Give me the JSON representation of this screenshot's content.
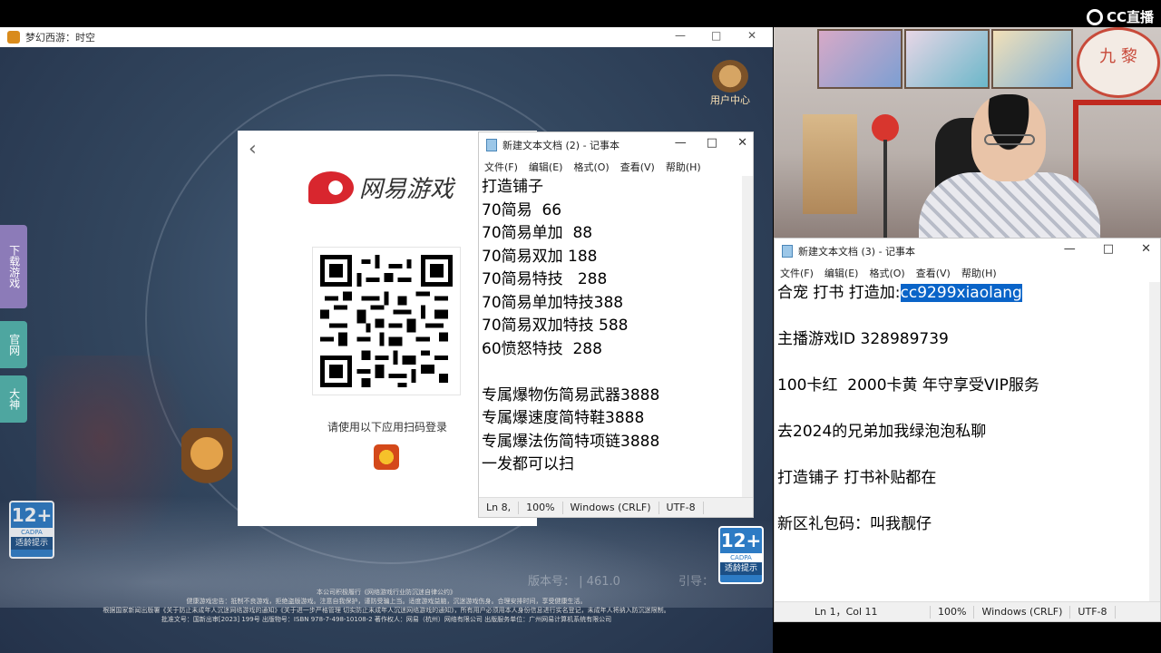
{
  "platform": {
    "logo_text": "CC直播"
  },
  "game_window": {
    "title": "梦幻西游：时空",
    "min": "—",
    "max": "□",
    "close": "✕",
    "user_center": "用户中心",
    "side_tabs": {
      "download": "下载游戏",
      "official": "官网",
      "dashen": "大神"
    },
    "version_label": "版本号：",
    "version_value": "| 461.0",
    "index_label": "引导：",
    "age_rating": {
      "age": "12+",
      "org": "CADPA",
      "tip": "适龄提示"
    },
    "legal_lines": [
      "本公司积极履行《网络游戏行业防沉迷自律公约》",
      "健康游戏忠告：抵制不良游戏，拒绝盗版游戏。注意自我保护，谨防受骗上当。适度游戏益脑，沉迷游戏伤身。合理安排时间，享受健康生活。",
      "根据国家新闻出版署《关于防止未成年人沉迷网络游戏的通知》《关于进一步严格管理 切实防止未成年人沉迷网络游戏的通知》，所有用户必须用本人身份信息进行实名登记，未成年人将纳入防沉迷限制。",
      "批准文号：国新出审[2023] 199号 出版物号：ISBN 978-7-498-10108-2 著作权人：网易（杭州）网络有限公司 出版服务单位：广州网易计算机系统有限公司"
    ]
  },
  "login_panel": {
    "back": "‹",
    "brand": "网易游戏",
    "hint": "请使用以下应用扫码登录"
  },
  "notepad1": {
    "title": "新建文本文档 (2) - 记事本",
    "menu": [
      "文件(F)",
      "编辑(E)",
      "格式(O)",
      "查看(V)",
      "帮助(H)"
    ],
    "lines": [
      "打造铺子",
      "70简易  66",
      "70简易单加  88",
      "70简易双加 188",
      "70简易特技   288",
      "70简易单加特技388",
      "70简易双加特技 588",
      "60愤怒特技  288",
      "",
      "专属爆物伤简易武器3888",
      "专属爆速度简特鞋3888",
      "专属爆法伤简特项链3888",
      "一发都可以扫"
    ],
    "status": {
      "pos": "Ln 8,",
      "zoom": "100%",
      "eol": "Windows (CRLF)",
      "enc": "UTF-8"
    }
  },
  "notepad2": {
    "title": "新建文本文档 (3) - 记事本",
    "menu": [
      "文件(F)",
      "编辑(E)",
      "格式(O)",
      "查看(V)",
      "帮助(H)"
    ],
    "line1_prefix": "合宠 打书 打造加:",
    "line1_selected": "cc9299xiaolang",
    "lines": [
      "",
      "主播游戏ID 328989739",
      "",
      "100卡红  2000卡黄 年守享受VIP服务",
      "",
      "去2024的兄弟加我绿泡泡私聊",
      "",
      "打造铺子 打书补贴都在",
      "",
      "新区礼包码：叫我靓仔"
    ],
    "status": {
      "pos": "Ln 1，Col 11",
      "zoom": "100%",
      "eol": "Windows (CRLF)",
      "enc": "UTF-8"
    }
  },
  "webcam": {
    "plate_text": "九 黎"
  }
}
